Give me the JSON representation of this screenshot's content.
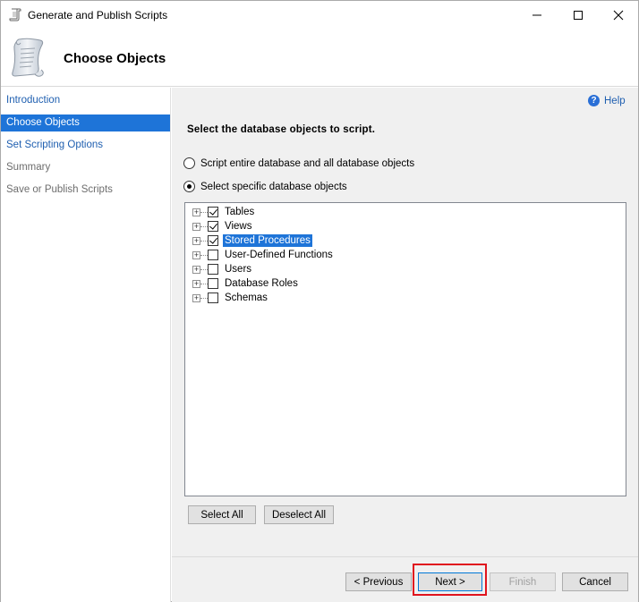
{
  "window": {
    "title": "Generate and Publish Scripts",
    "minimize_icon": "minimize-icon",
    "maximize_icon": "maximize-icon",
    "close_icon": "close-icon"
  },
  "header": {
    "title": "Choose Objects",
    "icon": "script-scroll-icon"
  },
  "nav": {
    "items": [
      {
        "label": "Introduction",
        "state": "link"
      },
      {
        "label": "Choose Objects",
        "state": "selected"
      },
      {
        "label": "Set Scripting Options",
        "state": "link"
      },
      {
        "label": "Summary",
        "state": "inactive"
      },
      {
        "label": "Save or Publish Scripts",
        "state": "inactive"
      }
    ]
  },
  "main": {
    "help_label": "Help",
    "prompt": "Select the database objects to script.",
    "radio_entire": "Script entire database and all database objects",
    "radio_specific": "Select specific database objects",
    "selected_radio": "specific",
    "tree": [
      {
        "label": "Tables",
        "checked": true,
        "highlighted": false
      },
      {
        "label": "Views",
        "checked": true,
        "highlighted": false
      },
      {
        "label": "Stored Procedures",
        "checked": true,
        "highlighted": true
      },
      {
        "label": "User-Defined Functions",
        "checked": false,
        "highlighted": false
      },
      {
        "label": "Users",
        "checked": false,
        "highlighted": false
      },
      {
        "label": "Database Roles",
        "checked": false,
        "highlighted": false
      },
      {
        "label": "Schemas",
        "checked": false,
        "highlighted": false
      }
    ],
    "select_all": "Select All",
    "deselect_all": "Deselect All"
  },
  "footer": {
    "previous": "< Previous",
    "next": "Next >",
    "finish": "Finish",
    "cancel": "Cancel"
  },
  "colors": {
    "selection": "#1e74d8",
    "link": "#1f5fb0",
    "highlight_frame": "#e0141e"
  }
}
